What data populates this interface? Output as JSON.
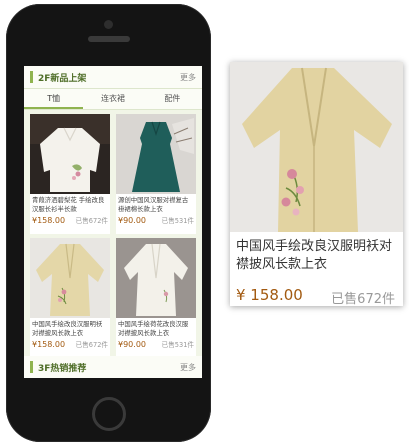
{
  "section1": {
    "title": "2F新品上架",
    "more": "更多"
  },
  "tabs": [
    "T恤",
    "连衣裙",
    "配件"
  ],
  "products": [
    {
      "name": "青葭济洒碧梨花 手绘改良汉服长衫半长款",
      "price": "¥158.00",
      "sold": "已售672件"
    },
    {
      "name": "源创中国风汉服对襟复古褂裙棉长款上衣",
      "price": "¥90.00",
      "sold": "已售531件"
    },
    {
      "name": "中国风手绘改良汉服明袄对襟披风长款上衣",
      "price": "¥158.00",
      "sold": "已售672件"
    },
    {
      "name": "中国风手绘荷花改良汉服对襟披风长款上衣",
      "price": "¥90.00",
      "sold": "已售531件"
    }
  ],
  "section2": {
    "title": "3F热销推荐",
    "more": "更多"
  },
  "zoom": {
    "name": "中国风手绘改良汉服明袄对襟披风长款上衣",
    "price": "¥ 158.00",
    "sold": "已售672件"
  }
}
